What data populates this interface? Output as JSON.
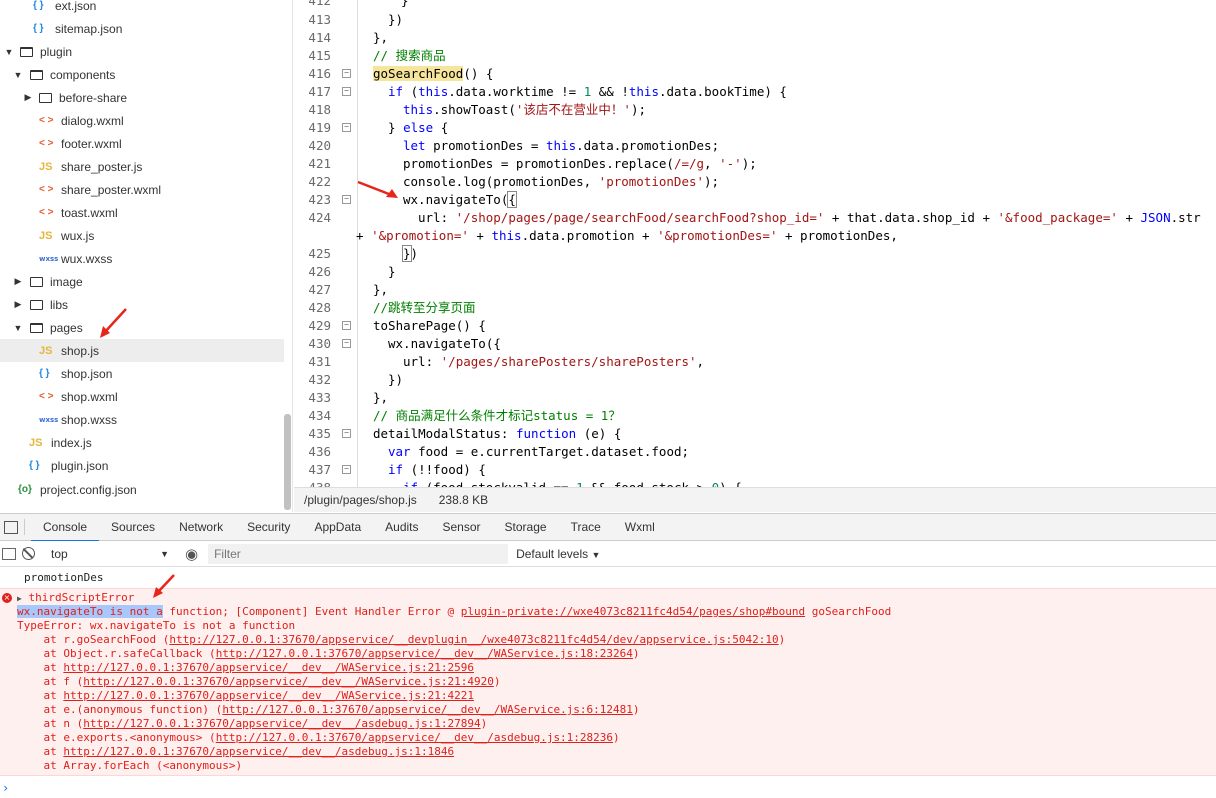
{
  "sidebar": {
    "items": [
      {
        "label": "ext.json",
        "icon": "json-icon"
      },
      {
        "label": "sitemap.json",
        "icon": "json-icon"
      },
      {
        "label": "plugin",
        "icon": "folder-open-icon"
      },
      {
        "label": "components",
        "icon": "folder-open-icon"
      },
      {
        "label": "before-share",
        "icon": "folder-icon"
      },
      {
        "label": "dialog.wxml",
        "icon": "wxml-icon"
      },
      {
        "label": "footer.wxml",
        "icon": "wxml-icon"
      },
      {
        "label": "share_poster.js",
        "icon": "js-icon"
      },
      {
        "label": "share_poster.wxml",
        "icon": "wxml-icon"
      },
      {
        "label": "toast.wxml",
        "icon": "wxml-icon"
      },
      {
        "label": "wux.js",
        "icon": "js-icon"
      },
      {
        "label": "wux.wxss",
        "icon": "wxss-icon"
      },
      {
        "label": "image",
        "icon": "folder-icon"
      },
      {
        "label": "libs",
        "icon": "folder-icon"
      },
      {
        "label": "pages",
        "icon": "folder-open-icon"
      },
      {
        "label": "shop.js",
        "icon": "js-icon"
      },
      {
        "label": "shop.json",
        "icon": "json-icon"
      },
      {
        "label": "shop.wxml",
        "icon": "wxml-icon"
      },
      {
        "label": "shop.wxss",
        "icon": "wxss-icon"
      },
      {
        "label": "index.js",
        "icon": "js-icon"
      },
      {
        "label": "plugin.json",
        "icon": "json-icon"
      },
      {
        "label": "project.config.json",
        "icon": "config-icon"
      }
    ]
  },
  "icons": {
    "json": "{ }",
    "xml": "< >",
    "js": "JS",
    "wxss": "wxss",
    "config": "{o}"
  },
  "editor": {
    "line_numbers": [
      "412",
      "413",
      "414",
      "415",
      "416",
      "417",
      "418",
      "419",
      "420",
      "421",
      "422",
      "423",
      "424",
      "425",
      "426",
      "427",
      "428",
      "429",
      "430",
      "431",
      "432",
      "433",
      "434",
      "435",
      "436",
      "437",
      "438"
    ],
    "status_path": "/plugin/pages/shop.js",
    "status_size": "238.8 KB"
  },
  "devtools": {
    "tabs": [
      "Console",
      "Sources",
      "Network",
      "Security",
      "AppData",
      "Audits",
      "Sensor",
      "Storage",
      "Trace",
      "Wxml"
    ],
    "context": "top",
    "filter_placeholder": "Filter",
    "levels": "Default levels",
    "log_text": "promotionDes",
    "error_title": "thirdScriptError",
    "error_main_sel": "wx.navigateTo is not a",
    "error_main_rest": " function; [Component] Event Handler Error @ ",
    "error_main_link": "plugin-private://wxe4073c8211fc4d54/pages/shop#bound",
    "error_main_end": " goSearchFood",
    "type_error": "TypeError: wx.navigateTo is not a function",
    "stack": [
      {
        "pre": "    at r.goSearchFood (",
        "link": "http://127.0.0.1:37670/appservice/__devplugin__/wxe4073c8211fc4d54/dev/appservice.js:5042:10",
        "post": ")"
      },
      {
        "pre": "    at Object.r.safeCallback (",
        "link": "http://127.0.0.1:37670/appservice/__dev__/WAService.js:18:23264",
        "post": ")"
      },
      {
        "pre": "    at ",
        "link": "http://127.0.0.1:37670/appservice/__dev__/WAService.js:21:2596",
        "post": ""
      },
      {
        "pre": "    at f (",
        "link": "http://127.0.0.1:37670/appservice/__dev__/WAService.js:21:4920",
        "post": ")"
      },
      {
        "pre": "    at ",
        "link": "http://127.0.0.1:37670/appservice/__dev__/WAService.js:21:4221",
        "post": ""
      },
      {
        "pre": "    at e.(anonymous function) (",
        "link": "http://127.0.0.1:37670/appservice/__dev__/WAService.js:6:12481",
        "post": ")"
      },
      {
        "pre": "    at n (",
        "link": "http://127.0.0.1:37670/appservice/__dev__/asdebug.js:1:27894",
        "post": ")"
      },
      {
        "pre": "    at e.exports.<anonymous> (",
        "link": "http://127.0.0.1:37670/appservice/__dev__/asdebug.js:1:28236",
        "post": ")"
      },
      {
        "pre": "    at ",
        "link": "http://127.0.0.1:37670/appservice/__dev__/asdebug.js:1:1846",
        "post": ""
      },
      {
        "pre": "    at Array.forEach (<anonymous>)",
        "link": "",
        "post": ""
      }
    ],
    "prompt": "›"
  },
  "colors": {
    "accent": "#1a73e8",
    "error": "#e0201a",
    "error_bg": "#fff0f0",
    "annotation": "#e8251b"
  }
}
